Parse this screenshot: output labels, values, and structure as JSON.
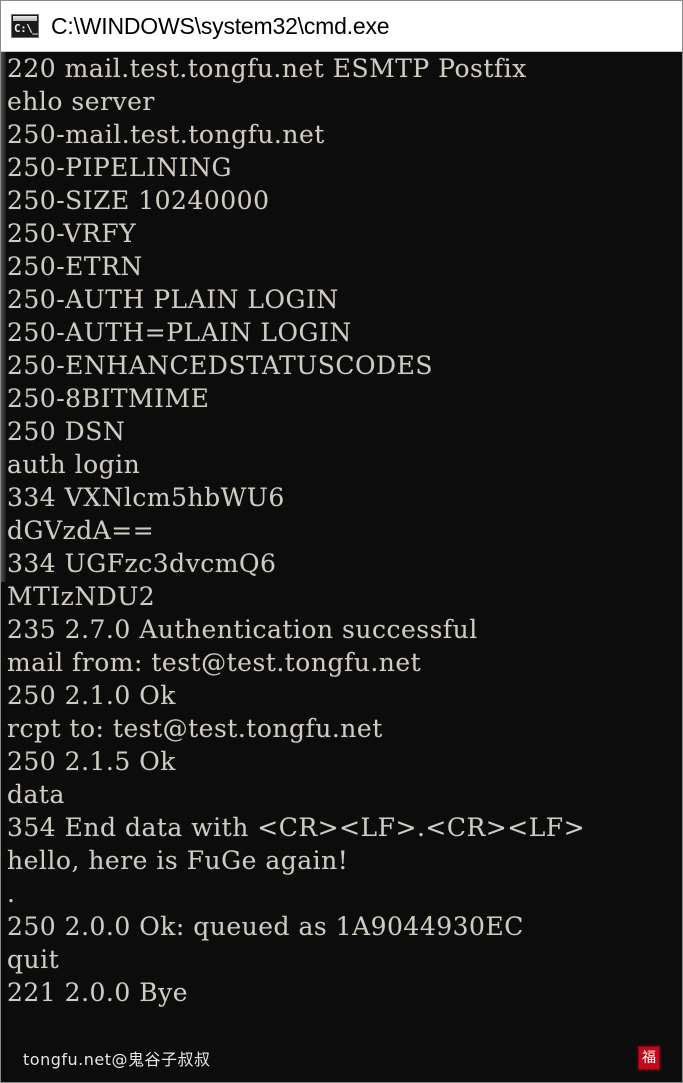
{
  "window": {
    "title": "C:\\WINDOWS\\system32\\cmd.exe",
    "icon": "cmd-prompt-icon",
    "icon_glyph": "C:\\_",
    "background_color": "#0c0c0c",
    "titlebar_color": "#ffffff",
    "text_color": "#d0ccc4"
  },
  "console": {
    "lines": [
      "220 mail.test.tongfu.net ESMTP Postfix",
      "ehlo server",
      "250-mail.test.tongfu.net",
      "250-PIPELINING",
      "250-SIZE 10240000",
      "250-VRFY",
      "250-ETRN",
      "250-AUTH PLAIN LOGIN",
      "250-AUTH=PLAIN LOGIN",
      "250-ENHANCEDSTATUSCODES",
      "250-8BITMIME",
      "250 DSN",
      "auth login",
      "334 VXNlcm5hbWU6",
      "dGVzdA==",
      "334 UGFzc3dvcmQ6",
      "MTIzNDU2",
      "235 2.7.0 Authentication successful",
      "mail from: test@test.tongfu.net",
      "250 2.1.0 Ok",
      "rcpt to: test@test.tongfu.net",
      "250 2.1.5 Ok",
      "data",
      "354 End data with <CR><LF>.<CR><LF>",
      "hello, here is FuGe again!",
      ".",
      "250 2.0.0 Ok: queued as 1A9044930EC",
      "quit",
      "221 2.0.0 Bye"
    ]
  },
  "footer": {
    "watermark": "tongfu.net@鬼谷子叔叔",
    "badge_text": "福",
    "badge_color": "#c0091a"
  }
}
